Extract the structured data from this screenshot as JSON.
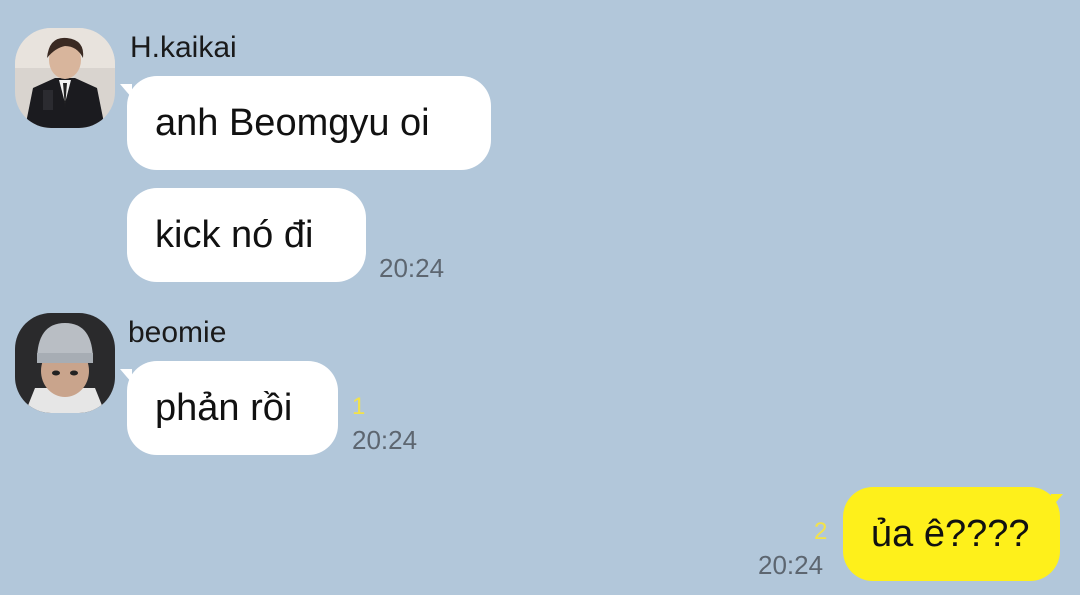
{
  "messages": [
    {
      "sender": "H.kaikai",
      "avatar_icon": "avatar-person-dark-jacket",
      "bubbles": [
        "anh Beomgyu oi",
        "kick nó đi"
      ],
      "time": "20:24"
    },
    {
      "sender": "beomie",
      "avatar_icon": "avatar-person-beanie",
      "bubbles": [
        "phản rồi"
      ],
      "unread_count": "1",
      "time": "20:24"
    },
    {
      "sender": "me",
      "bubbles": [
        "ủa ê????"
      ],
      "unread_count": "2",
      "time": "20:24"
    }
  ],
  "colors": {
    "background": "#b2c7da",
    "incoming_bubble": "#ffffff",
    "outgoing_bubble": "#fef01b",
    "unread": "#f3e24a",
    "timestamp": "#5d6670"
  }
}
